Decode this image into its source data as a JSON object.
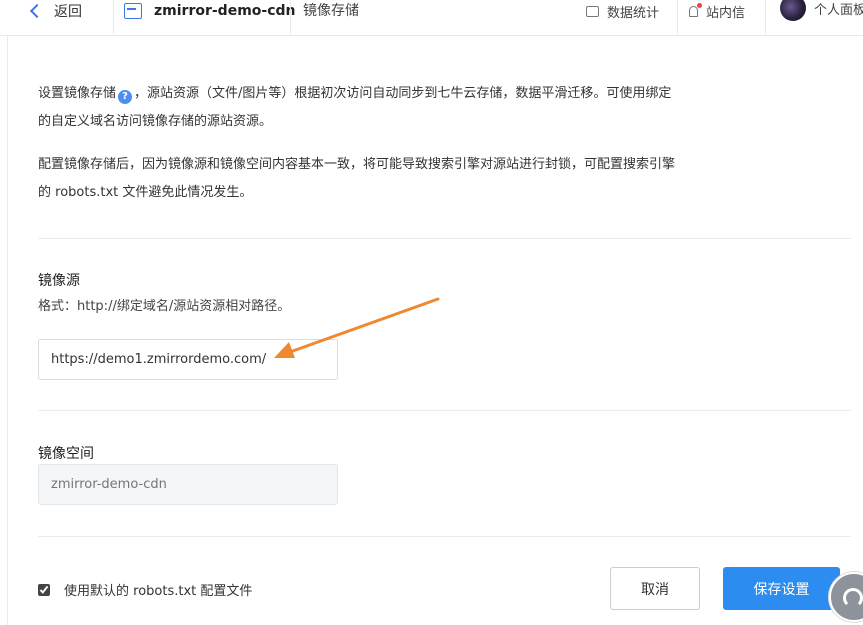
{
  "header": {
    "back_label": "返回",
    "bucket_name": "zmirror-demo-cdn",
    "page_name": "镜像存储",
    "stats_label": "数据统计",
    "messages_label": "站内信",
    "user_label": "个人面板"
  },
  "intro": {
    "p1_before": "设置镜像存储",
    "help_glyph": "?",
    "p1_after": "，源站资源（文件/图片等）根据初次访问自动同步到七牛云存储，数据平滑迁移。可使用绑定的自定义域名访问镜像存储的源站资源。",
    "p2": "配置镜像存储后，因为镜像源和镜像空间内容基本一致，将可能导致搜索引擎对源站进行封锁，可配置搜索引擎的 robots.txt 文件避免此情况发生。"
  },
  "mirror_source": {
    "title": "镜像源",
    "hint": "格式：http://绑定域名/源站资源相对路径。",
    "value": "https://demo1.zmirrordemo.com/"
  },
  "mirror_bucket": {
    "title": "镜像空间",
    "placeholder": "zmirror-demo-cdn"
  },
  "footer": {
    "robots_label": "使用默认的 robots.txt 配置文件",
    "robots_checked": true,
    "cancel_label": "取消",
    "save_label": "保存设置"
  },
  "colors": {
    "primary": "#2d8cf0",
    "annotation_arrow": "#f0882e",
    "notification_dot": "#f04040"
  }
}
